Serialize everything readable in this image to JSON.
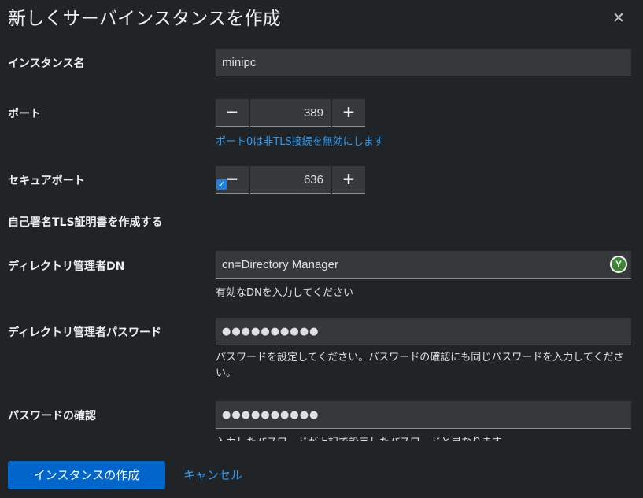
{
  "modal": {
    "title": "新しくサーバインスタンスを作成",
    "close_glyph": "✕"
  },
  "form": {
    "instance_name": {
      "label": "インスタンス名",
      "value": "minipc"
    },
    "port": {
      "label": "ポート",
      "minus": "−",
      "value": "389",
      "plus": "+",
      "helper": "ポート0は非TLS接続を無効にします"
    },
    "secure_port": {
      "label": "セキュアポート",
      "minus": "−",
      "value": "636",
      "plus": "+"
    },
    "self_signed": {
      "label": "自己署名TLS証明書を作成する",
      "checked": true,
      "check_glyph": "✓"
    },
    "dm_dn": {
      "label": "ディレクトリ管理者DN",
      "value": "cn=Directory Manager",
      "helper": "有効なDNを入力してください",
      "valid_icon_glyph": "Y"
    },
    "dm_password": {
      "label": "ディレクトリ管理者パスワード",
      "value": "●●●●●●●●●●",
      "helper": "パスワードを設定してください。パスワードの確認にも同じパスワードを入力してください。"
    },
    "password_confirm": {
      "label": "パスワードの確認",
      "value": "●●●●●●●●●●",
      "helper": "入力したパスワードが上記で設定したパスワードと異なります"
    }
  },
  "footer": {
    "create_label": "インスタンスの作成",
    "cancel_label": "キャンセル"
  },
  "colors": {
    "background": "#212427",
    "field": "#36383c",
    "primary": "#0066cc",
    "link": "#2b9af3",
    "success": "#3e8635"
  }
}
